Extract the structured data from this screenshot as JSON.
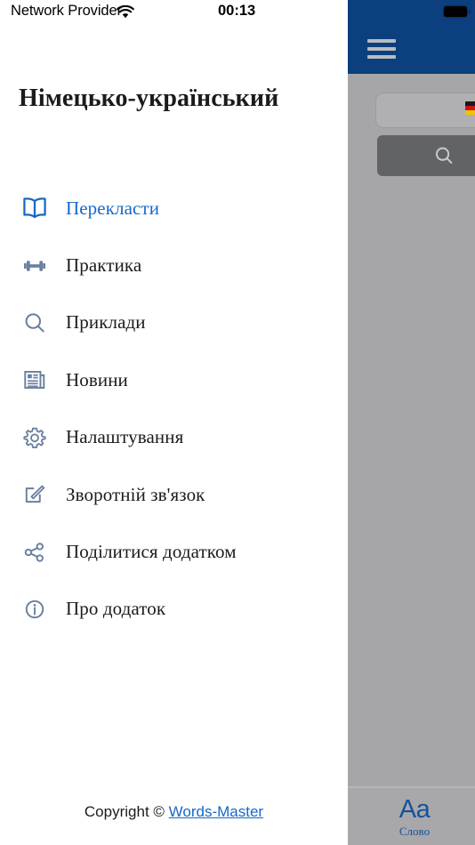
{
  "status_bar": {
    "carrier": "Network Provider",
    "wifi_icon": "wifi-icon",
    "time": "00:13"
  },
  "drawer": {
    "title": "Німецько-український",
    "items": [
      {
        "label": "Перекласти",
        "icon": "book-open-icon",
        "active": true
      },
      {
        "label": "Практика",
        "icon": "dumbbell-icon",
        "active": false
      },
      {
        "label": "Приклади",
        "icon": "search-icon",
        "active": false
      },
      {
        "label": "Новини",
        "icon": "newspaper-icon",
        "active": false
      },
      {
        "label": "Налаштування",
        "icon": "gear-icon",
        "active": false
      },
      {
        "label": "Зворотній зв'язок",
        "icon": "edit-square-icon",
        "active": false
      },
      {
        "label": "Поділитися додатком",
        "icon": "share-icon",
        "active": false
      },
      {
        "label": "Про додаток",
        "icon": "info-circle-icon",
        "active": false
      }
    ],
    "footer": {
      "copyright_prefix": "Copyright © ",
      "link_label": "Words-Master"
    }
  },
  "app": {
    "header": {
      "menu_icon": "hamburger-menu-icon",
      "battery_icon": "battery-full-icon",
      "background_color": "#0b3f7e"
    },
    "search": {
      "input_value": "",
      "flag_icon": "german-flag-icon",
      "button_icon": "search-icon"
    },
    "tabbar": {
      "items": [
        {
          "icon_text": "Aa",
          "label": "Слово",
          "active": true
        }
      ]
    }
  },
  "colors": {
    "accent_blue": "#1668c8",
    "header_navy": "#0b3f7e",
    "icon_gray_blue": "#6b7f9e",
    "overlay_gray": "#a6a6a8"
  }
}
